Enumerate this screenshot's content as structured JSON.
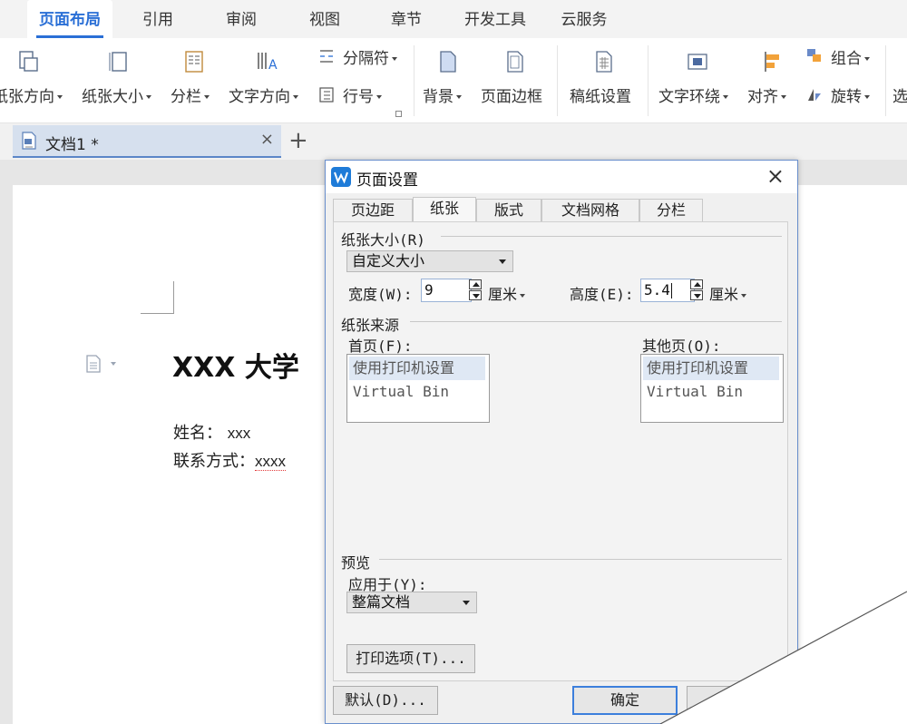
{
  "menubar": {
    "tabs": [
      "页面布局",
      "引用",
      "审阅",
      "视图",
      "章节",
      "开发工具",
      "云服务"
    ]
  },
  "ribbon": {
    "orientation": "纸张方向",
    "size": "纸张大小",
    "columns": "分栏",
    "text_direction": "文字方向",
    "breaks": "分隔符",
    "line_numbers": "行号",
    "background": "背景",
    "page_border": "页面边框",
    "manuscript": "稿纸设置",
    "wrap_text": "文字环绕",
    "align": "对齐",
    "group": "组合",
    "rotate": "旋转",
    "select": "选"
  },
  "doc_tab": {
    "name": "文档1 *",
    "close": "×",
    "new_tab": "+"
  },
  "document": {
    "title": "XXX 大学",
    "name_label": "姓名：",
    "name_value": "xxx",
    "contact_label": "联系方式：",
    "contact_value": "xxxx"
  },
  "dialog": {
    "title": "页面设置",
    "close": "×",
    "tabs": [
      "页边距",
      "纸张",
      "版式",
      "文档网格",
      "分栏"
    ],
    "active_tab": "纸张",
    "paper_size": {
      "section": "纸张大小(R)",
      "preset": "自定义大小",
      "width_label": "宽度(W):",
      "width_value": "9",
      "height_label": "高度(E):",
      "height_value": "5.4",
      "unit": "厘米"
    },
    "paper_source": {
      "section": "纸张来源",
      "first_page_label": "首页(F):",
      "other_pages_label": "其他页(O):",
      "items": [
        "使用打印机设置",
        "Virtual Bin"
      ]
    },
    "preview": {
      "section": "预览",
      "apply_to_label": "应用于(Y):",
      "apply_to_value": "整篇文档",
      "print_options": "打印选项(T)..."
    },
    "buttons": {
      "default": "默认(D)...",
      "ok": "确定"
    }
  },
  "colors": {
    "accent": "#2a6fd6",
    "dialog_border": "#6a8fcc",
    "wps_logo": "#1e7bd8"
  }
}
